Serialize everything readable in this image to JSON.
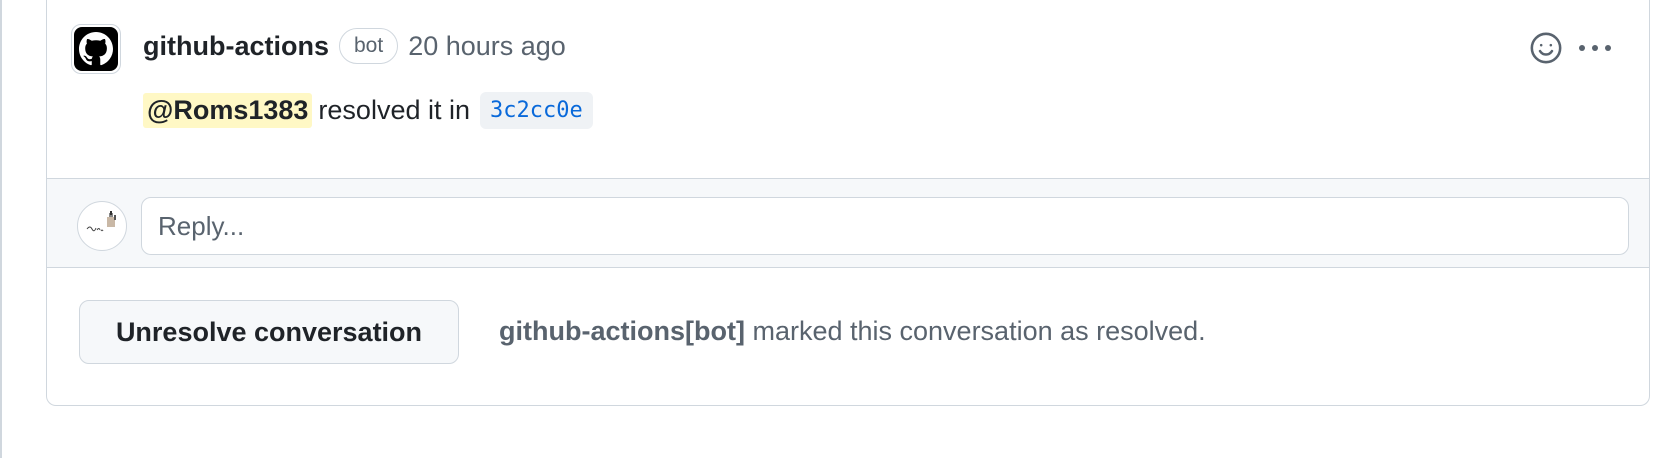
{
  "comment": {
    "author": "github-actions",
    "author_badge": "bot",
    "timestamp": "20 hours ago",
    "mention": "@Roms1383",
    "body_text": "resolved it in",
    "commit_sha": "3c2cc0e",
    "avatar_icon": "github-mark-icon",
    "reaction_icon": "smiley-icon",
    "menu_icon": "kebab-horizontal-icon"
  },
  "reply": {
    "placeholder": "Reply...",
    "avatar_icon": "user-avatar"
  },
  "footer": {
    "unresolve_label": "Unresolve conversation",
    "resolved_actor": "github-actions[bot]",
    "resolved_text": "marked this conversation as resolved."
  },
  "colors": {
    "border": "#d0d7de",
    "muted_text": "#59636e",
    "link": "#0969da",
    "mention_bg": "#fff8c5",
    "reply_bar_bg": "#f6f8fa"
  }
}
